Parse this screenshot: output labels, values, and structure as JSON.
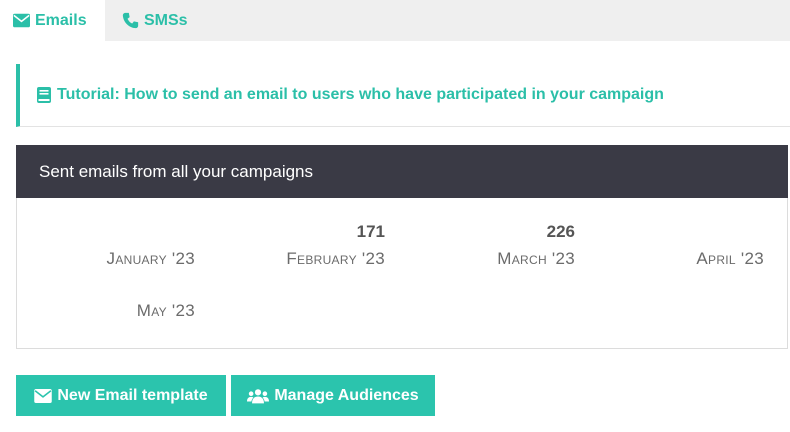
{
  "tabs": [
    {
      "label": "Emails",
      "icon": "envelope-icon",
      "active": true
    },
    {
      "label": "SMSs",
      "icon": "phone-icon",
      "active": false
    }
  ],
  "tutorial": {
    "label": "Tutorial: How to send an email to users who have participated in your campaign",
    "icon": "book-icon"
  },
  "stats_card": {
    "title": "Sent emails from all your campaigns",
    "months": [
      {
        "label": "January '23",
        "count": ""
      },
      {
        "label": "February '23",
        "count": "171"
      },
      {
        "label": "March '23",
        "count": "226"
      },
      {
        "label": "April '23",
        "count": ""
      },
      {
        "label": "May '23",
        "count": ""
      }
    ]
  },
  "buttons": {
    "new_template": {
      "label": "New Email template",
      "icon": "envelope-icon"
    },
    "manage_audiences": {
      "label": "Manage Audiences",
      "icon": "users-icon"
    }
  },
  "colors": {
    "accent": "#2bbfa8",
    "button": "#2bc4ad",
    "header_bg": "#3a3a45",
    "tabbar_bg": "#efefef"
  }
}
